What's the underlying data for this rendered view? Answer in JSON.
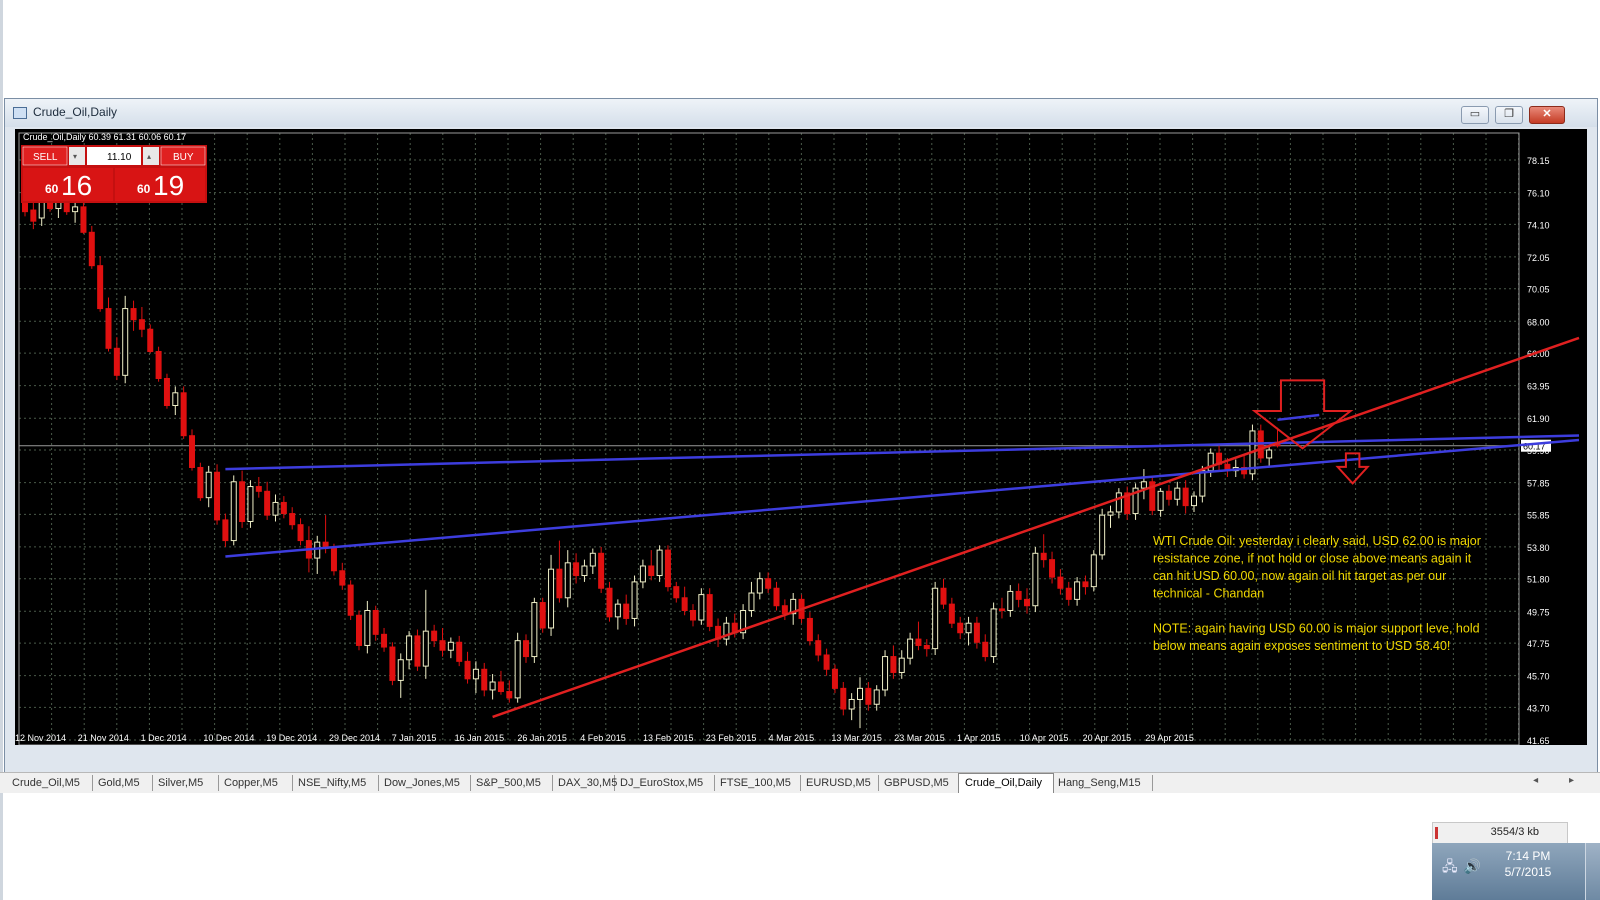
{
  "window": {
    "title": "Crude_Oil,Daily",
    "minimize": "▭",
    "maximize": "❐",
    "close": "✕"
  },
  "chart_header": {
    "symbol_line": "Crude_Oil,Daily  60.39 61.31 60.06 60.17"
  },
  "trade_panel": {
    "sell_label": "SELL",
    "buy_label": "BUY",
    "volume": "11.10",
    "sell_big": "60",
    "sell_small": "16",
    "buy_big": "60",
    "buy_small": "19"
  },
  "annotation": {
    "lines": [
      "WTI Crude Oil: yesterday i clearly said, USD 62.00 is major",
      "resistance zone, if not hold or close above means again it",
      "can hit USD 60.00, now again oil hit target as per our",
      "technical - Chandan",
      "",
      "NOTE: again having USD 60.00 is major support leve, hold",
      "below means again exposes sentiment to USD 58.40!"
    ]
  },
  "colors": {
    "chart_bg": "#000000",
    "grid": "#4a5a4a",
    "bull_candle": "#f0f0c8",
    "bear_candle": "#e01010",
    "blue_lines": "#3d3dde",
    "red_trend": "#e02020",
    "annotation_text": "#f0d800",
    "axis_text": "#ffffff"
  },
  "chart_data": {
    "type": "candlestick",
    "ylim": [
      41.65,
      78.15
    ],
    "y_ticks": [
      "78.15",
      "76.10",
      "74.10",
      "72.05",
      "70.05",
      "68.00",
      "66.00",
      "63.95",
      "61.90",
      "59.90",
      "57.85",
      "55.85",
      "53.80",
      "51.80",
      "49.75",
      "47.75",
      "45.70",
      "43.70",
      "41.65"
    ],
    "x_ticks": [
      "12 Nov 2014",
      "21 Nov 2014",
      "1 Dec 2014",
      "10 Dec 2014",
      "19 Dec 2014",
      "29 Dec 2014",
      "7 Jan 2015",
      "16 Jan 2015",
      "26 Jan 2015",
      "4 Feb 2015",
      "13 Feb 2015",
      "23 Feb 2015",
      "4 Mar 2015",
      "13 Mar 2015",
      "23 Mar 2015",
      "1 Apr 2015",
      "10 Apr 2015",
      "20 Apr 2015",
      "29 Apr 2015"
    ],
    "current_price_label": "60.17",
    "current_price": 60.17,
    "ohlc": [
      [
        75.5,
        76.2,
        74.6,
        74.9
      ],
      [
        75.0,
        75.8,
        73.8,
        74.3
      ],
      [
        74.5,
        75.9,
        74.0,
        75.6
      ],
      [
        75.6,
        76.4,
        74.9,
        75.1
      ],
      [
        75.1,
        76.0,
        74.5,
        75.7
      ],
      [
        75.7,
        76.3,
        74.7,
        74.9
      ],
      [
        74.9,
        75.7,
        74.2,
        75.2
      ],
      [
        75.2,
        75.5,
        73.5,
        73.6
      ],
      [
        73.6,
        74.0,
        71.3,
        71.5
      ],
      [
        71.5,
        72.1,
        68.6,
        68.8
      ],
      [
        68.8,
        69.5,
        66.1,
        66.3
      ],
      [
        66.3,
        67.0,
        64.3,
        64.6
      ],
      [
        64.6,
        69.6,
        64.1,
        68.8
      ],
      [
        68.8,
        69.3,
        67.4,
        68.1
      ],
      [
        68.1,
        68.9,
        67.0,
        67.5
      ],
      [
        67.5,
        67.8,
        66.0,
        66.1
      ],
      [
        66.1,
        66.4,
        64.2,
        64.4
      ],
      [
        64.4,
        64.7,
        62.5,
        62.7
      ],
      [
        62.7,
        63.9,
        62.1,
        63.5
      ],
      [
        63.5,
        63.9,
        60.6,
        60.8
      ],
      [
        60.8,
        61.2,
        58.6,
        58.8
      ],
      [
        58.8,
        59.1,
        56.7,
        56.9
      ],
      [
        56.9,
        58.9,
        56.3,
        58.5
      ],
      [
        58.5,
        59.0,
        55.2,
        55.5
      ],
      [
        55.5,
        55.9,
        53.8,
        54.2
      ],
      [
        54.2,
        58.3,
        53.9,
        57.9
      ],
      [
        57.9,
        58.6,
        55.0,
        55.4
      ],
      [
        55.4,
        58.0,
        55.0,
        57.6
      ],
      [
        57.6,
        58.2,
        56.9,
        57.3
      ],
      [
        57.3,
        57.9,
        55.5,
        55.8
      ],
      [
        55.8,
        57.1,
        55.4,
        56.6
      ],
      [
        56.6,
        57.0,
        55.6,
        55.9
      ],
      [
        55.9,
        56.3,
        54.9,
        55.2
      ],
      [
        55.2,
        55.6,
        53.9,
        54.2
      ],
      [
        54.2,
        55.1,
        52.2,
        53.1
      ],
      [
        53.1,
        54.5,
        52.1,
        54.1
      ],
      [
        54.1,
        55.8,
        53.4,
        53.7
      ],
      [
        53.7,
        54.0,
        52.0,
        52.3
      ],
      [
        52.3,
        52.8,
        51.1,
        51.4
      ],
      [
        51.4,
        51.7,
        49.2,
        49.5
      ],
      [
        49.5,
        49.8,
        47.3,
        47.6
      ],
      [
        47.6,
        50.4,
        47.1,
        49.8
      ],
      [
        49.8,
        50.1,
        47.9,
        48.3
      ],
      [
        48.3,
        48.7,
        47.2,
        47.5
      ],
      [
        47.5,
        47.8,
        45.1,
        45.4
      ],
      [
        45.4,
        47.1,
        44.3,
        46.7
      ],
      [
        46.7,
        48.5,
        46.1,
        48.2
      ],
      [
        48.2,
        48.6,
        46.0,
        46.3
      ],
      [
        46.3,
        51.1,
        45.5,
        48.5
      ],
      [
        48.5,
        48.9,
        47.5,
        47.9
      ],
      [
        47.9,
        48.7,
        46.9,
        47.3
      ],
      [
        47.3,
        48.1,
        46.8,
        47.8
      ],
      [
        47.8,
        48.2,
        46.3,
        46.6
      ],
      [
        46.6,
        47.2,
        45.2,
        45.5
      ],
      [
        45.5,
        46.6,
        44.6,
        46.1
      ],
      [
        46.1,
        46.5,
        44.4,
        44.8
      ],
      [
        44.8,
        45.8,
        44.2,
        45.3
      ],
      [
        45.3,
        46.0,
        44.5,
        44.7
      ],
      [
        44.7,
        45.4,
        44.0,
        44.3
      ],
      [
        44.3,
        48.4,
        44.0,
        47.9
      ],
      [
        47.9,
        48.3,
        46.5,
        46.9
      ],
      [
        46.9,
        50.6,
        46.5,
        50.3
      ],
      [
        50.3,
        50.6,
        48.4,
        48.7
      ],
      [
        48.7,
        53.3,
        48.2,
        52.4
      ],
      [
        52.4,
        54.2,
        50.3,
        50.6
      ],
      [
        50.6,
        53.6,
        50.0,
        52.8
      ],
      [
        52.8,
        53.4,
        51.5,
        52.0
      ],
      [
        52.0,
        53.0,
        51.6,
        52.6
      ],
      [
        52.6,
        53.7,
        52.1,
        53.4
      ],
      [
        53.4,
        53.8,
        50.9,
        51.2
      ],
      [
        51.2,
        51.6,
        49.1,
        49.4
      ],
      [
        49.4,
        50.5,
        48.6,
        50.2
      ],
      [
        50.2,
        50.8,
        48.9,
        49.3
      ],
      [
        49.3,
        52.0,
        48.8,
        51.6
      ],
      [
        51.6,
        53.0,
        51.2,
        52.6
      ],
      [
        52.6,
        53.6,
        51.7,
        52.0
      ],
      [
        52.0,
        53.9,
        51.6,
        53.6
      ],
      [
        53.6,
        53.9,
        51.0,
        51.3
      ],
      [
        51.3,
        51.6,
        50.3,
        50.6
      ],
      [
        50.6,
        51.3,
        49.5,
        49.8
      ],
      [
        49.8,
        50.2,
        48.8,
        49.2
      ],
      [
        49.2,
        51.2,
        48.9,
        50.8
      ],
      [
        50.8,
        51.2,
        48.5,
        48.8
      ],
      [
        48.8,
        49.3,
        47.5,
        48.0
      ],
      [
        48.0,
        49.4,
        47.6,
        49.0
      ],
      [
        49.0,
        49.6,
        48.1,
        48.4
      ],
      [
        48.4,
        50.2,
        48.0,
        49.8
      ],
      [
        49.8,
        51.6,
        49.4,
        50.9
      ],
      [
        50.9,
        52.2,
        50.5,
        51.8
      ],
      [
        51.8,
        52.2,
        50.9,
        51.2
      ],
      [
        51.2,
        51.6,
        49.8,
        50.1
      ],
      [
        50.1,
        50.5,
        49.2,
        49.6
      ],
      [
        49.6,
        50.9,
        48.9,
        50.5
      ],
      [
        50.5,
        50.8,
        49.0,
        49.3
      ],
      [
        49.3,
        49.7,
        47.6,
        47.9
      ],
      [
        47.9,
        48.3,
        46.6,
        47.0
      ],
      [
        47.0,
        47.4,
        45.7,
        46.1
      ],
      [
        46.1,
        46.4,
        44.6,
        44.9
      ],
      [
        44.9,
        45.3,
        43.2,
        43.6
      ],
      [
        43.6,
        44.6,
        42.9,
        44.2
      ],
      [
        44.2,
        45.6,
        42.4,
        44.9
      ],
      [
        44.9,
        45.3,
        43.5,
        43.9
      ],
      [
        43.9,
        45.1,
        43.5,
        44.8
      ],
      [
        44.8,
        47.3,
        44.4,
        46.9
      ],
      [
        46.9,
        47.6,
        45.5,
        45.9
      ],
      [
        45.9,
        47.3,
        45.5,
        46.8
      ],
      [
        46.8,
        48.4,
        46.4,
        48.0
      ],
      [
        48.0,
        49.1,
        47.3,
        47.6
      ],
      [
        47.6,
        48.0,
        46.9,
        47.4
      ],
      [
        47.4,
        51.6,
        47.0,
        51.2
      ],
      [
        51.2,
        51.8,
        49.9,
        50.2
      ],
      [
        50.2,
        50.6,
        48.7,
        49.0
      ],
      [
        49.0,
        49.4,
        48.0,
        48.4
      ],
      [
        48.4,
        49.4,
        47.6,
        49.0
      ],
      [
        49.0,
        49.4,
        47.4,
        47.8
      ],
      [
        47.8,
        48.3,
        46.6,
        46.9
      ],
      [
        46.9,
        50.3,
        46.5,
        49.9
      ],
      [
        49.9,
        50.6,
        49.3,
        49.8
      ],
      [
        49.8,
        51.4,
        49.4,
        51.0
      ],
      [
        51.0,
        51.5,
        50.0,
        50.5
      ],
      [
        50.5,
        51.2,
        49.6,
        50.1
      ],
      [
        50.1,
        53.8,
        49.7,
        53.4
      ],
      [
        53.4,
        54.6,
        52.5,
        53.0
      ],
      [
        53.0,
        53.5,
        51.5,
        51.9
      ],
      [
        51.9,
        52.4,
        50.8,
        51.2
      ],
      [
        51.2,
        51.6,
        50.1,
        50.5
      ],
      [
        50.5,
        51.9,
        50.1,
        51.6
      ],
      [
        51.6,
        52.0,
        50.8,
        51.3
      ],
      [
        51.3,
        53.6,
        51.0,
        53.3
      ],
      [
        53.3,
        56.2,
        53.0,
        55.8
      ],
      [
        55.8,
        56.4,
        55.0,
        56.0
      ],
      [
        56.0,
        57.5,
        55.6,
        57.2
      ],
      [
        57.2,
        57.6,
        55.5,
        55.9
      ],
      [
        55.9,
        57.8,
        55.5,
        57.5
      ],
      [
        57.5,
        58.7,
        56.8,
        57.9
      ],
      [
        57.9,
        58.2,
        55.8,
        56.1
      ],
      [
        56.1,
        57.5,
        55.7,
        57.3
      ],
      [
        57.3,
        57.7,
        56.4,
        56.8
      ],
      [
        56.8,
        57.9,
        56.4,
        57.5
      ],
      [
        57.5,
        58.0,
        55.9,
        56.4
      ],
      [
        56.4,
        57.3,
        56.0,
        57.0
      ],
      [
        57.0,
        58.9,
        56.6,
        58.6
      ],
      [
        58.6,
        60.0,
        58.2,
        59.7
      ],
      [
        59.7,
        60.2,
        58.6,
        59.0
      ],
      [
        59.0,
        59.4,
        58.2,
        58.6
      ],
      [
        58.6,
        59.3,
        58.2,
        58.8
      ],
      [
        58.8,
        59.6,
        58.1,
        58.4
      ],
      [
        58.4,
        61.5,
        58.0,
        61.1
      ],
      [
        61.1,
        61.5,
        59.1,
        59.4
      ],
      [
        59.4,
        60.1,
        58.9,
        59.9
      ],
      [
        60.39,
        61.31,
        60.06,
        60.17
      ]
    ],
    "lines": [
      {
        "name": "",
        "color": "blue",
        "from": [
          24,
          58.7
        ],
        "to": [
          170,
          60.6
        ]
      },
      {
        "name": "",
        "color": "blue",
        "from": [
          24,
          53.2
        ],
        "to": [
          170,
          59.8
        ]
      },
      {
        "name": "",
        "color": "blue",
        "from": [
          150,
          61.8
        ],
        "to": [
          155,
          62.1
        ]
      },
      {
        "name": "",
        "color": "red",
        "from": [
          56,
          43.1
        ],
        "to": [
          170,
          64.0
        ]
      }
    ],
    "arrows": [
      {
        "name": "big-down-arrow",
        "at": [
          153,
          60.0
        ],
        "size": "large"
      },
      {
        "name": "small-down-arrow",
        "at": [
          159,
          57.8
        ],
        "size": "small"
      }
    ]
  },
  "tabs": [
    {
      "label": "Crude_Oil,M5"
    },
    {
      "label": "Gold,M5"
    },
    {
      "label": "Silver,M5"
    },
    {
      "label": "Copper,M5"
    },
    {
      "label": "NSE_Nifty,M5"
    },
    {
      "label": "Dow_Jones,M5"
    },
    {
      "label": "S&P_500,M5"
    },
    {
      "label": "DAX_30,M5"
    },
    {
      "label": "DJ_EuroStox,M5"
    },
    {
      "label": "FTSE_100,M5"
    },
    {
      "label": "EURUSD,M5"
    },
    {
      "label": "GBPUSD,M5"
    },
    {
      "label": "Crude_Oil,Daily",
      "active": true
    },
    {
      "label": "Hang_Seng,M15"
    }
  ],
  "tab_nav": "◂ ▸",
  "status": {
    "traffic": "3554/3 kb"
  },
  "taskbar": {
    "time": "7:14 PM",
    "date": "5/7/2015",
    "tray_icons": "network-icon speaker-icon"
  }
}
